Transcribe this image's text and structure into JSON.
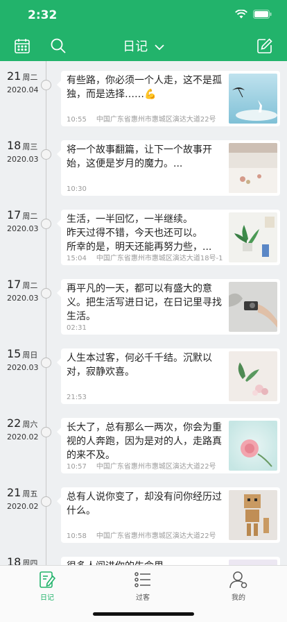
{
  "status": {
    "time": "2:32"
  },
  "nav": {
    "title": "日记"
  },
  "theme": {
    "accent": "#22b36b"
  },
  "entries": [
    {
      "day": "21",
      "weekday": "周二",
      "yearmonth": "2020.04",
      "text": "有些路，你必须一个人走，这不是孤独，而是选择……💪",
      "time": "10:55",
      "location": "中国广东省惠州市惠城区演达大道22号",
      "image": "umbrella-sky-photo"
    },
    {
      "day": "18",
      "weekday": "周三",
      "yearmonth": "2020.03",
      "text": "将一个故事翻篇，让下一个故事开始，这便是岁月的魔力。...",
      "time": "10:30",
      "location": "",
      "image": "bedroom-photo"
    },
    {
      "day": "17",
      "weekday": "周二",
      "yearmonth": "2020.03",
      "text": "生活，一半回忆，一半继续。\n昨天过得不错，今天也还可以。\n所幸的是，明天还能再努力些，...",
      "time": "15:04",
      "location": "中国广东省惠州市惠城区演达大道18号-1",
      "image": "plant-desk-photo"
    },
    {
      "day": "17",
      "weekday": "周二",
      "yearmonth": "2020.03",
      "text": "再平凡的一天，都可以有盛大的意义。把生活写进日记，在日记里寻找生活。",
      "time": "02:31",
      "location": "",
      "image": "camera-hand-photo"
    },
    {
      "day": "15",
      "weekday": "周日",
      "yearmonth": "2020.03",
      "text": "人生本过客，何必千千结。沉默以对，寂静欢喜。",
      "time": "21:53",
      "location": "",
      "image": "plant-flowers-photo"
    },
    {
      "day": "22",
      "weekday": "周六",
      "yearmonth": "2020.02",
      "text": "长大了，总有那么一两次，你会为重视的人奔跑，因为是对的人，走路真的来不及。",
      "time": "10:57",
      "location": "中国广东省惠州市惠城区演达大道22号",
      "image": "pink-flower-photo"
    },
    {
      "day": "21",
      "weekday": "周五",
      "yearmonth": "2020.02",
      "text": "总有人说你变了，却没有问你经历过什么。",
      "time": "10:58",
      "location": "中国广东省惠州市惠城区演达大道22号",
      "image": "cardboard-robot-photo"
    },
    {
      "day": "18",
      "weekday": "周四",
      "yearmonth": "",
      "text": "很多人闯进你的生命里",
      "time": "",
      "location": "",
      "image": "partial-photo"
    }
  ],
  "tabs": [
    {
      "label": "日记",
      "icon": "diary-icon",
      "active": true
    },
    {
      "label": "过客",
      "icon": "list-icon",
      "active": false
    },
    {
      "label": "我的",
      "icon": "profile-icon",
      "active": false
    }
  ]
}
